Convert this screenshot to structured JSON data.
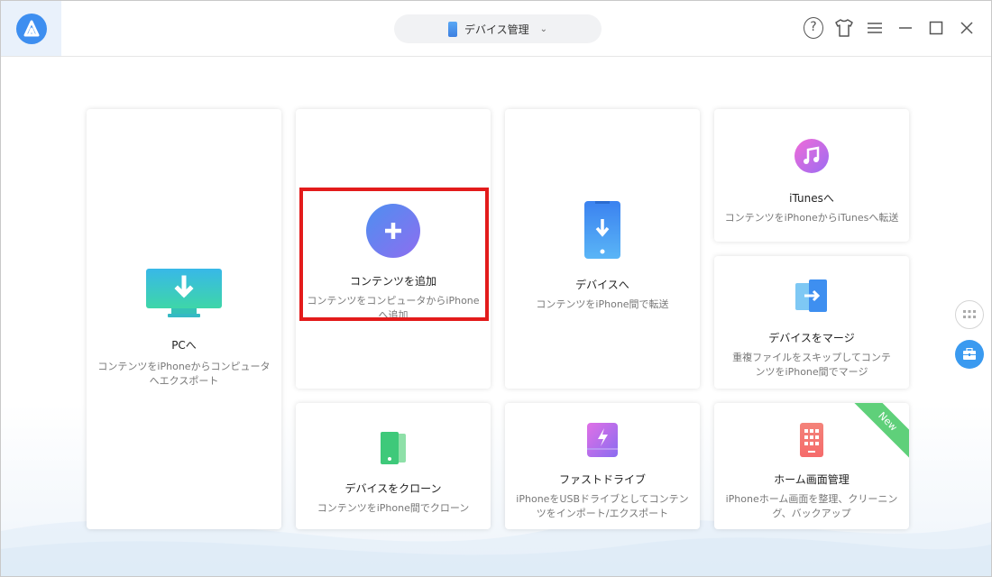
{
  "header": {
    "device_selector": "デバイス管理",
    "chevron_icon": "chevron-down-icon"
  },
  "window_controls": [
    "help-icon",
    "skin-icon",
    "menu-icon",
    "minimize-icon",
    "maximize-icon",
    "close-icon"
  ],
  "cards": {
    "to_pc": {
      "title": "PCへ",
      "desc": "コンテンツをiPhoneからコンピュータへエクスポート"
    },
    "add_content": {
      "title": "コンテンツを追加",
      "desc": "コンテンツをコンピュータからiPhoneへ追加"
    },
    "to_device": {
      "title": "デバイスへ",
      "desc": "コンテンツをiPhone間で転送"
    },
    "to_itunes": {
      "title": "iTunesへ",
      "desc": "コンテンツをiPhoneからiTunesへ転送"
    },
    "merge_device": {
      "title": "デバイスをマージ",
      "desc": "重複ファイルをスキップしてコンテンツをiPhone間でマージ"
    },
    "clone_device": {
      "title": "デバイスをクローン",
      "desc": "コンテンツをiPhone間でクローン"
    },
    "fast_drive": {
      "title": "ファストドライブ",
      "desc": "iPhoneをUSBドライブとしてコンテンツをインポート/エクスポート"
    },
    "home_screen": {
      "title": "ホーム画面管理",
      "desc": "iPhoneホーム画面を整理、クリーニング、バックアップ",
      "badge": "New"
    }
  },
  "colors": {
    "accent_blue": "#4a90e8",
    "highlight_red": "#e31b1b",
    "new_green": "#5fd07a"
  }
}
